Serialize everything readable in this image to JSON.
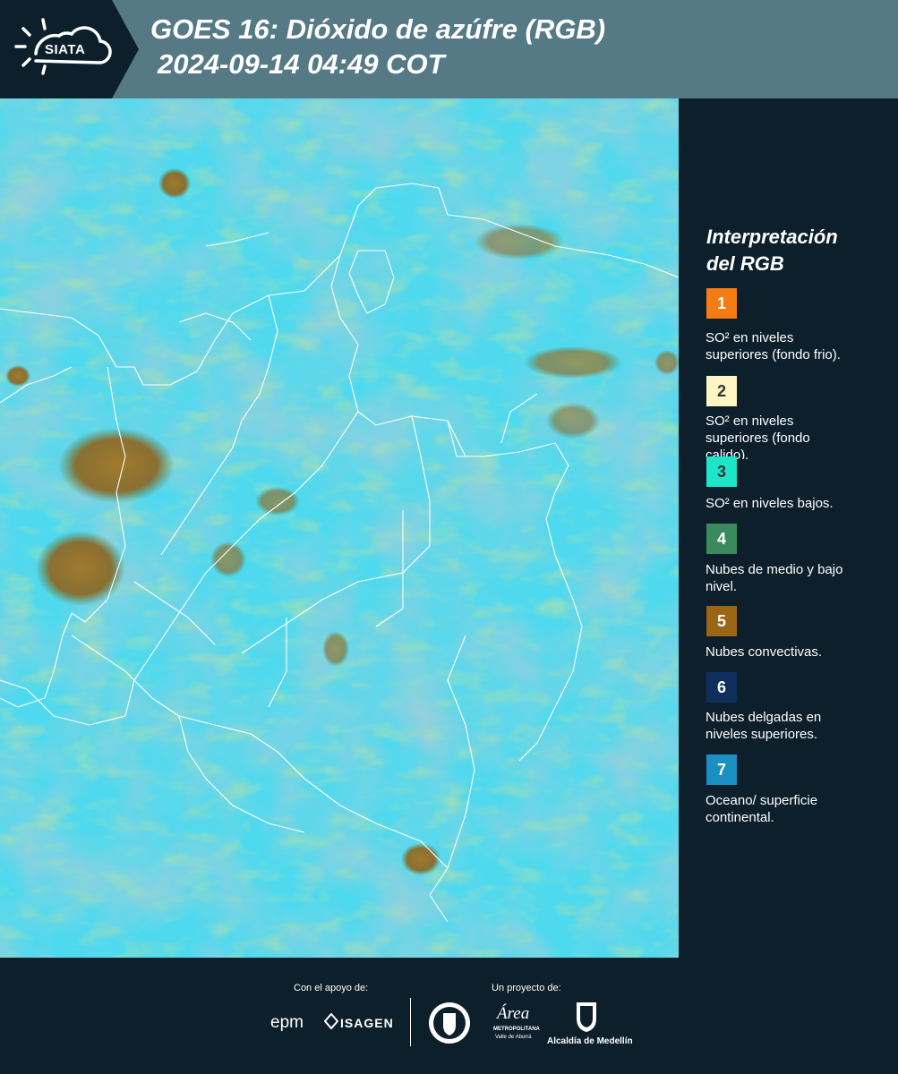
{
  "header": {
    "logo_text": "SIATA",
    "title_line1": "GOES 16: Dióxido de azúfre (RGB)",
    "title_line2": "2024-09-14 04:49 COT"
  },
  "legend": {
    "title_line1": "Interpretación",
    "title_line2": "del RGB",
    "items": [
      {
        "number": "1",
        "color": "#f57c12",
        "text_color": "#ffffff",
        "desc_line1": "SO² en niveles",
        "desc_line2": "superiores (fondo frio)."
      },
      {
        "number": "2",
        "color": "#fdf5c4",
        "text_color": "#333333",
        "desc_line1": "SO² en niveles",
        "desc_line2": "superiores (fondo",
        "desc_line3": "calido)."
      },
      {
        "number": "3",
        "color": "#1de6c8",
        "text_color": "#333333",
        "desc_line1": "SO² en niveles bajos."
      },
      {
        "number": "4",
        "color": "#3a8a5e",
        "text_color": "#ffffff",
        "desc_line1": "Nubes de medio y bajo",
        "desc_line2": "nivel."
      },
      {
        "number": "5",
        "color": "#9a6515",
        "text_color": "#ffffff",
        "desc_line1": "Nubes convectivas."
      },
      {
        "number": "6",
        "color": "#0e2f5c",
        "text_color": "#ffffff",
        "desc_line1": "Nubes delgadas en",
        "desc_line2": "niveles superiores."
      },
      {
        "number": "7",
        "color": "#1a8fc1",
        "text_color": "#ffffff",
        "desc_line1": "Oceano/ superficie",
        "desc_line2": "continental."
      }
    ]
  },
  "footer": {
    "support_label": "Con el apoyo de:",
    "project_label": "Un proyecto de:",
    "epm": "epm",
    "isagen": "ISAGEN",
    "area_metro": "Área",
    "area_metro_sub1": "METROPOLITANA",
    "area_metro_sub2": "Valle de Aburrá",
    "alcaldia": "Alcaldía de Medellín"
  }
}
